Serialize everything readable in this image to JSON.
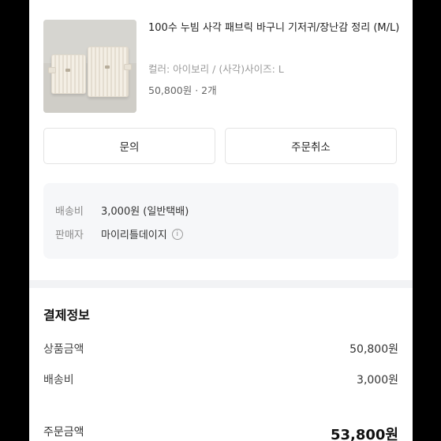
{
  "product": {
    "title": "100수 누빔 사각 패브릭 바구니 기저귀/장난감 정리 (M/L)",
    "option": "컬러: 아이보리 / (사각)사이즈: L",
    "price_qty": "50,800원 · 2개"
  },
  "buttons": {
    "inquiry": "문의",
    "cancel_order": "주문취소"
  },
  "shipping_info": {
    "fee_label": "배송비",
    "fee_value": "3,000원 (일반택배)",
    "seller_label": "판매자",
    "seller_value": "마이리틀데이지"
  },
  "payment": {
    "title": "결제정보",
    "rows": [
      {
        "label": "상품금액",
        "value": "50,800원"
      },
      {
        "label": "배송비",
        "value": "3,000원"
      }
    ],
    "total_label": "주문금액",
    "total_value": "53,800원"
  },
  "icons": {
    "info": "info-circle-icon"
  }
}
